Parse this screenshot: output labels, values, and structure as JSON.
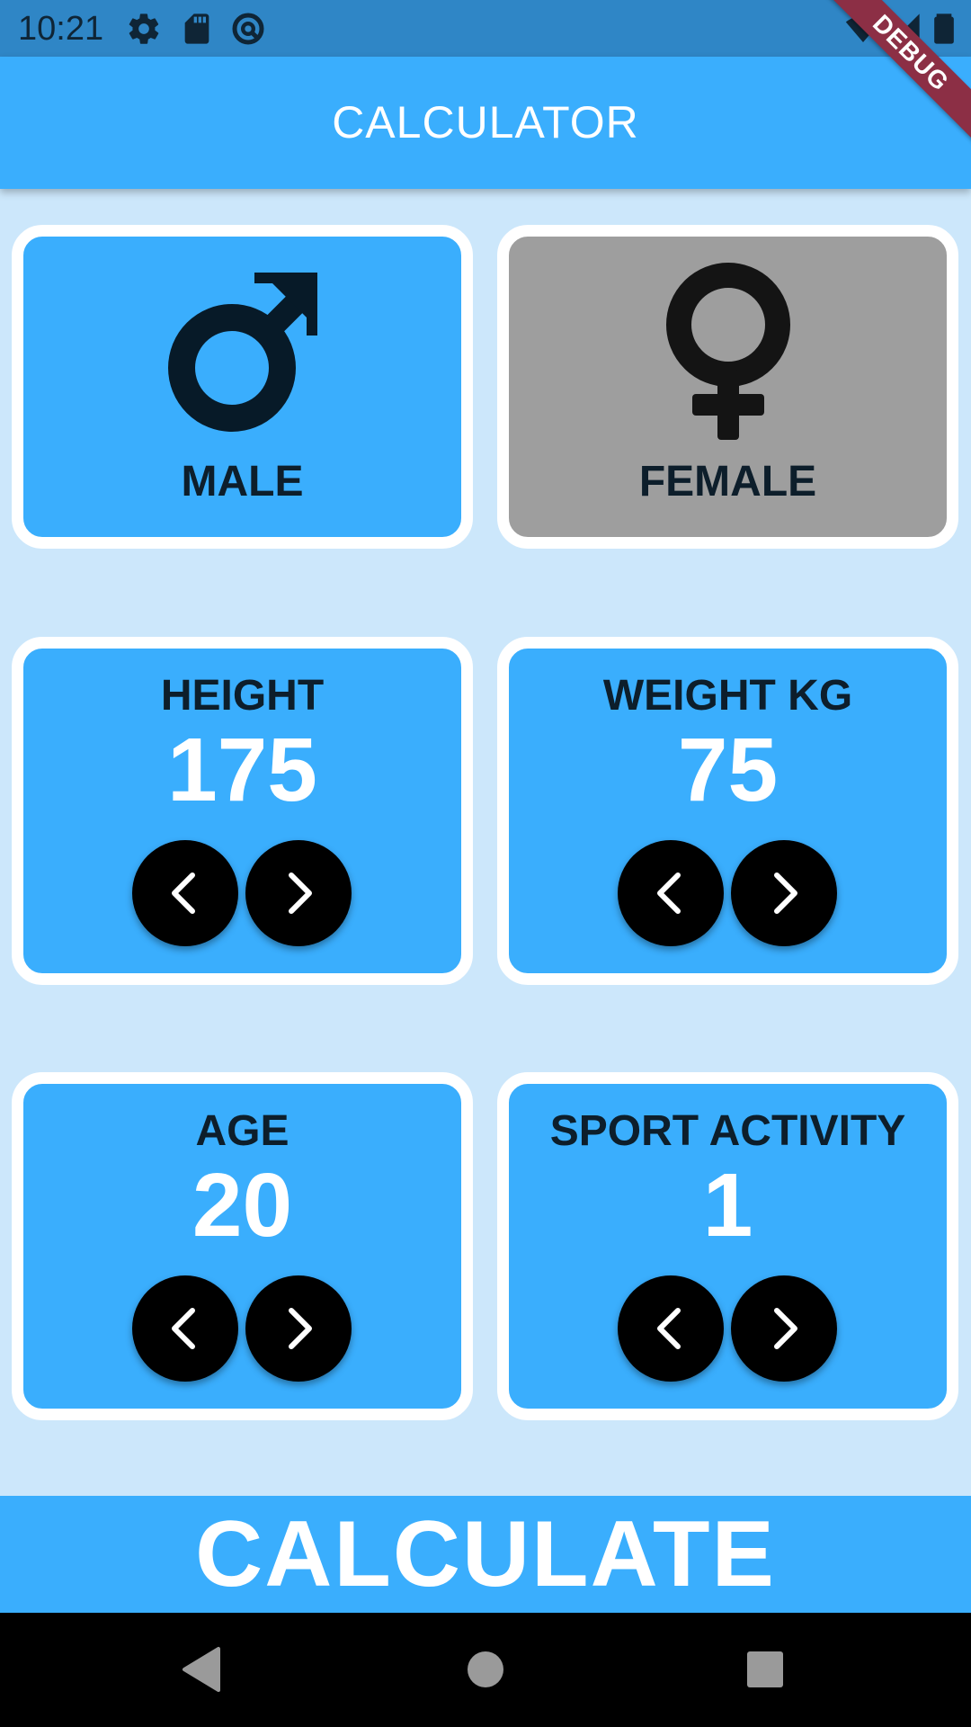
{
  "status_bar": {
    "time": "10:21",
    "icons": [
      "gear-icon",
      "sd-card-icon",
      "vpn-key-icon",
      "wifi-icon",
      "signal-icon",
      "battery-icon"
    ]
  },
  "debug_banner": "DEBUG",
  "app_bar": {
    "title": "CALCULATOR"
  },
  "gender": {
    "male": {
      "label": "MALE",
      "icon": "male-symbol-icon",
      "selected": true
    },
    "female": {
      "label": "FEMALE",
      "icon": "female-symbol-icon",
      "selected": false
    }
  },
  "counters": {
    "height": {
      "label": "HEIGHT",
      "value": "175"
    },
    "weight": {
      "label": "WEIGHT KG",
      "value": "75"
    },
    "age": {
      "label": "AGE",
      "value": "20"
    },
    "activity": {
      "label": "SPORT ACTIVITY",
      "value": "1"
    }
  },
  "calculate": {
    "label": "CALCULATE"
  },
  "colors": {
    "accent": "#3aaefd",
    "background": "#cce7fb",
    "inactive_card": "#9e9e9e",
    "status_bar": "#2f86c6",
    "debug_banner": "#8c2f45"
  },
  "nav_bar": {
    "buttons": [
      "back-icon",
      "home-icon",
      "recents-icon"
    ]
  }
}
